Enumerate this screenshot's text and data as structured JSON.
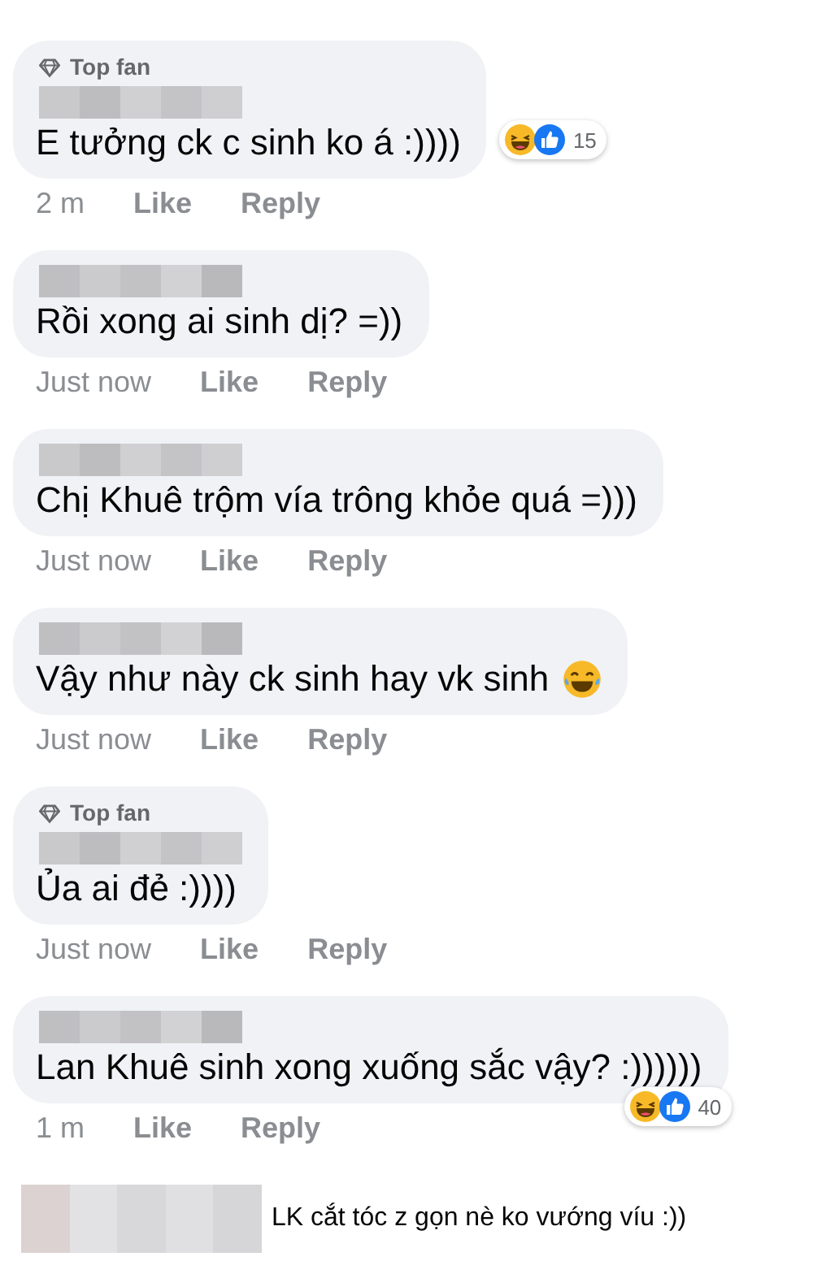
{
  "comments": [
    {
      "kind": "bubble",
      "top_fan": true,
      "badge": "Top fan",
      "text": "E tưởng ck c sinh ko á :))))",
      "reactions": {
        "below": false,
        "count": "15"
      },
      "meta": {
        "time": "2 m",
        "like": "Like",
        "reply": "Reply"
      }
    },
    {
      "kind": "bubble",
      "top_fan": false,
      "text": "Rồi xong ai sinh dị? =))",
      "meta": {
        "time": "Just now",
        "like": "Like",
        "reply": "Reply"
      }
    },
    {
      "kind": "bubble",
      "top_fan": false,
      "text": "Chị Khuê trộm vía trông khỏe quá =)))",
      "meta": {
        "time": "Just now",
        "like": "Like",
        "reply": "Reply"
      }
    },
    {
      "kind": "bubble",
      "top_fan": false,
      "text": "Vậy như này ck sinh hay vk sinh",
      "has_emoji": true,
      "meta": {
        "time": "Just now",
        "like": "Like",
        "reply": "Reply"
      }
    },
    {
      "kind": "bubble",
      "top_fan": true,
      "badge": "Top fan",
      "text": "Ủa ai đẻ :))))",
      "meta": {
        "time": "Just now",
        "like": "Like",
        "reply": "Reply"
      }
    },
    {
      "kind": "bubble",
      "top_fan": false,
      "text": "Lan Khuê sinh xong xuống sắc vậy? :))))))",
      "reactions": {
        "below": true,
        "count": "40"
      },
      "meta": {
        "time": "1 m",
        "like": "Like",
        "reply": "Reply"
      }
    },
    {
      "kind": "plain",
      "text": "LK cắt tóc z gọn nè ko vướng víu :))"
    }
  ]
}
